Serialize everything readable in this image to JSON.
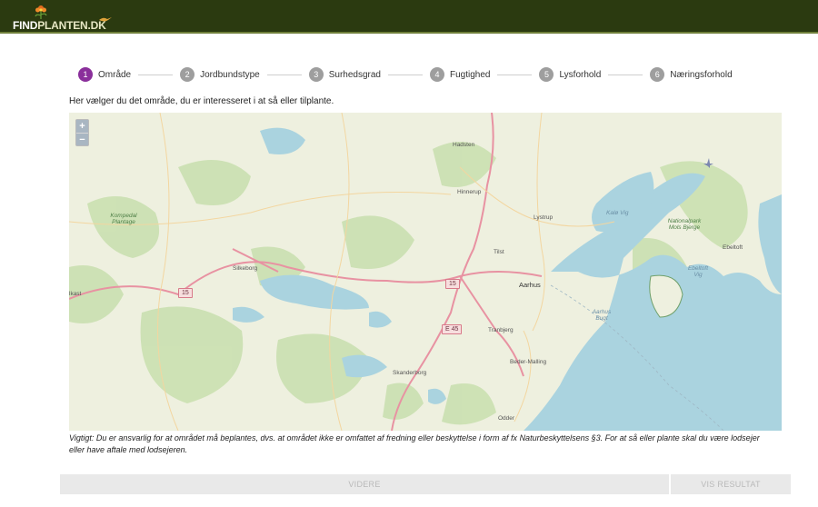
{
  "header": {
    "logo_find": "FIND",
    "logo_rest": "PLANTEN.DK"
  },
  "steps": [
    {
      "num": "1",
      "label": "Område"
    },
    {
      "num": "2",
      "label": "Jordbundstype"
    },
    {
      "num": "3",
      "label": "Surhedsgrad"
    },
    {
      "num": "4",
      "label": "Fugtighed"
    },
    {
      "num": "5",
      "label": "Lysforhold"
    },
    {
      "num": "6",
      "label": "Næringsforhold"
    }
  ],
  "active_step": 1,
  "intro": "Her vælger du det område, du er interesseret i at så eller tilplante.",
  "map": {
    "zoom_in": "+",
    "zoom_out": "−",
    "places": {
      "hadsten": "Hadsten",
      "hinnerup": "Hinnerup",
      "lystrup": "Lystrup",
      "tilst": "Tilst",
      "aarhus": "Aarhus",
      "silkeborg": "Silkeborg",
      "skanderborg": "Skanderborg",
      "tranbjerg": "Tranbjerg",
      "beder": "Beder-Malling",
      "odder": "Odder",
      "ebeltoft": "Ebeltoft",
      "kast": "lkast",
      "kompedal": "Kompedal Plantage",
      "nationalpark": "Nationalpark Mols Bjerge",
      "kalo": "Kalø Vig",
      "aarhus_bugt": "Aarhus Bugt",
      "ebeltoft_vig": "Ebeltoft Vig"
    },
    "roads": {
      "r15a": "15",
      "r15b": "15",
      "e45": "E 45"
    }
  },
  "notice": "Vigtigt: Du er ansvarlig for at området må beplantes, dvs. at området ikke er omfattet af fredning eller beskyttelse i form af fx Naturbeskyttelsens §3. For at så eller plante skal du være lodsejer eller have aftale med lodsejeren.",
  "buttons": {
    "next": "VIDERE",
    "result": "VIS RESULTAT"
  },
  "colors": {
    "header_bg": "#2b3a10",
    "active_step": "#8a2f9b",
    "inactive_step": "#9e9e9e",
    "sea": "#aad3df",
    "land": "#eef0df",
    "forest": "#c8dfae",
    "motorway": "#e892a2"
  }
}
